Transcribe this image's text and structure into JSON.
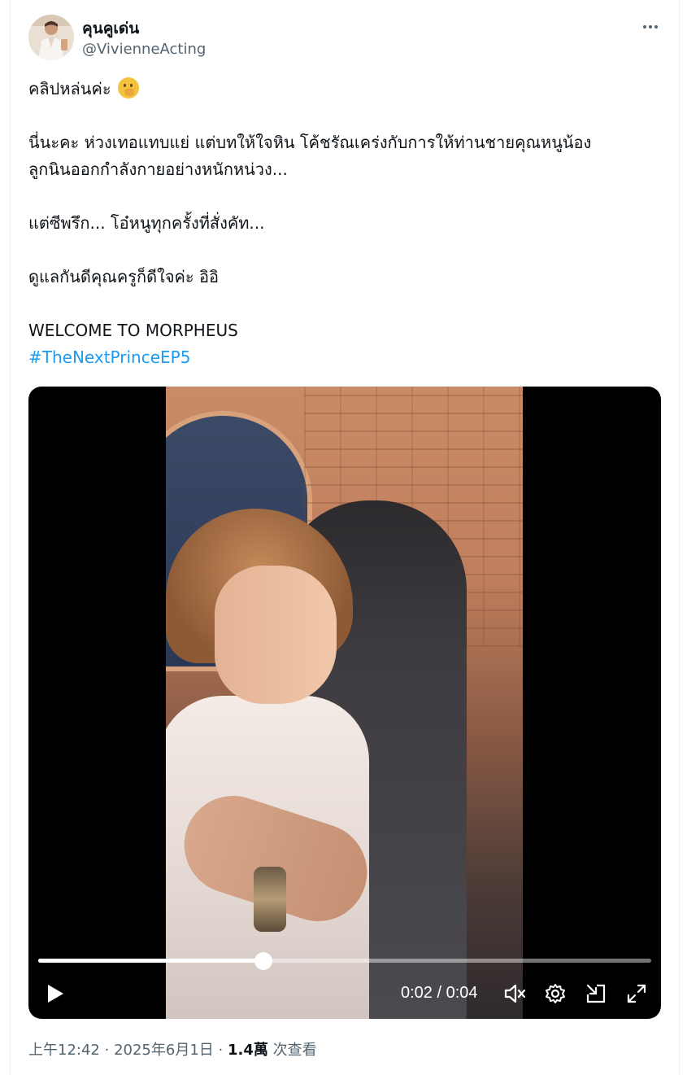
{
  "author": {
    "display_name": "คุนคูเด่น",
    "handle": "@VivienneActing",
    "avatar_icon": "profile-photo"
  },
  "more_icon": "ellipsis-icon",
  "tweet": {
    "lines": [
      "คลิปหล่นค่ะ",
      "",
      "นี่นะคะ ห่วงเทอแทบแย่ แต่บทให้ใจหิน โค้ชรัณเคร่งกับการให้ท่านชายคุณหนูน้อง",
      "ลูกนินออกกำลังกายอย่างหนักหน่วง...",
      "",
      "แต่ซีพรึก... โอ๋หนูทุกครั้งที่สั่งคัท...",
      "",
      "ดูแลกันดีคุณครูก็ดีใจค่ะ อิอิ",
      "",
      "WELCOME TO MORPHEUS"
    ],
    "emoji": "shushing-face",
    "hashtag": "#TheNextPrinceEP5"
  },
  "video": {
    "current_time": "0:02",
    "duration": "0:04",
    "time_display": "0:02 / 0:04",
    "progress": 0.367,
    "icons": [
      "play-icon",
      "volume-muted-icon",
      "settings-gear-icon",
      "picture-in-picture-icon",
      "fullscreen-icon"
    ]
  },
  "meta": {
    "time": "上午12:42",
    "separator": "·",
    "date": "2025年6月1日",
    "views_count": "1.4萬",
    "views_label": "次查看"
  },
  "colors": {
    "link": "#1d9bf0",
    "secondary_text": "#536471",
    "primary_text": "#0f1419"
  }
}
